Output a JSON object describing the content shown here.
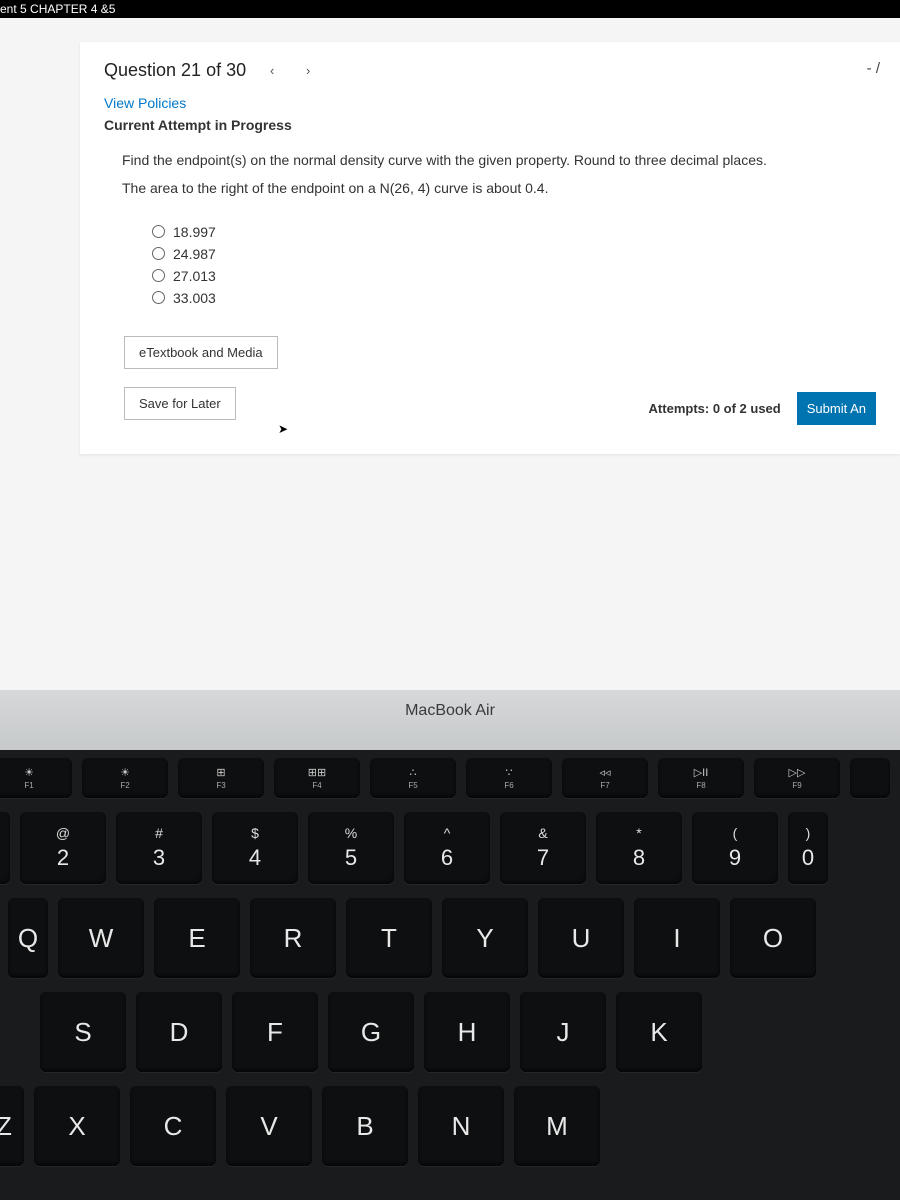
{
  "topbar": {
    "title": "ent 5 CHAPTER 4 &5"
  },
  "question": {
    "label": "Question 21 of 30",
    "score": "- /",
    "view_policies": "View Policies",
    "attempt_status": "Current Attempt in Progress",
    "prompt1": "Find the endpoint(s) on the normal density curve with the given property. Round to three decimal places.",
    "prompt2": "The area to the right of the endpoint on a N(26, 4) curve is about 0.4.",
    "options": [
      "18.997",
      "24.987",
      "27.013",
      "33.003"
    ],
    "etext_button": "eTextbook and Media",
    "save_button": "Save for Later",
    "attempts": "Attempts: 0 of 2 used",
    "submit_button": "Submit An"
  },
  "keyboard": {
    "brand": "MacBook Air",
    "fn_row": [
      {
        "icon": "☀",
        "lbl": "F1"
      },
      {
        "icon": "☀",
        "lbl": "F2"
      },
      {
        "icon": "⊞",
        "lbl": "F3"
      },
      {
        "icon": "⊞⊞",
        "lbl": "F4"
      },
      {
        "icon": "∴",
        "lbl": "F5"
      },
      {
        "icon": "∵",
        "lbl": "F6"
      },
      {
        "icon": "◃◃",
        "lbl": "F7"
      },
      {
        "icon": "▷II",
        "lbl": "F8"
      },
      {
        "icon": "▷▷",
        "lbl": "F9"
      }
    ],
    "num_row": [
      {
        "sym": "@",
        "num": "2"
      },
      {
        "sym": "#",
        "num": "3"
      },
      {
        "sym": "$",
        "num": "4"
      },
      {
        "sym": "%",
        "num": "5"
      },
      {
        "sym": "^",
        "num": "6"
      },
      {
        "sym": "&",
        "num": "7"
      },
      {
        "sym": "*",
        "num": "8"
      },
      {
        "sym": "(",
        "num": "9"
      },
      {
        "sym": ")",
        "num": "0"
      }
    ],
    "row_q": [
      "Q",
      "W",
      "E",
      "R",
      "T",
      "Y",
      "U",
      "I",
      "O"
    ],
    "row_a": [
      "S",
      "D",
      "F",
      "G",
      "H",
      "J",
      "K"
    ],
    "row_z": [
      "Z",
      "X",
      "C",
      "V",
      "B",
      "N",
      "M"
    ]
  }
}
